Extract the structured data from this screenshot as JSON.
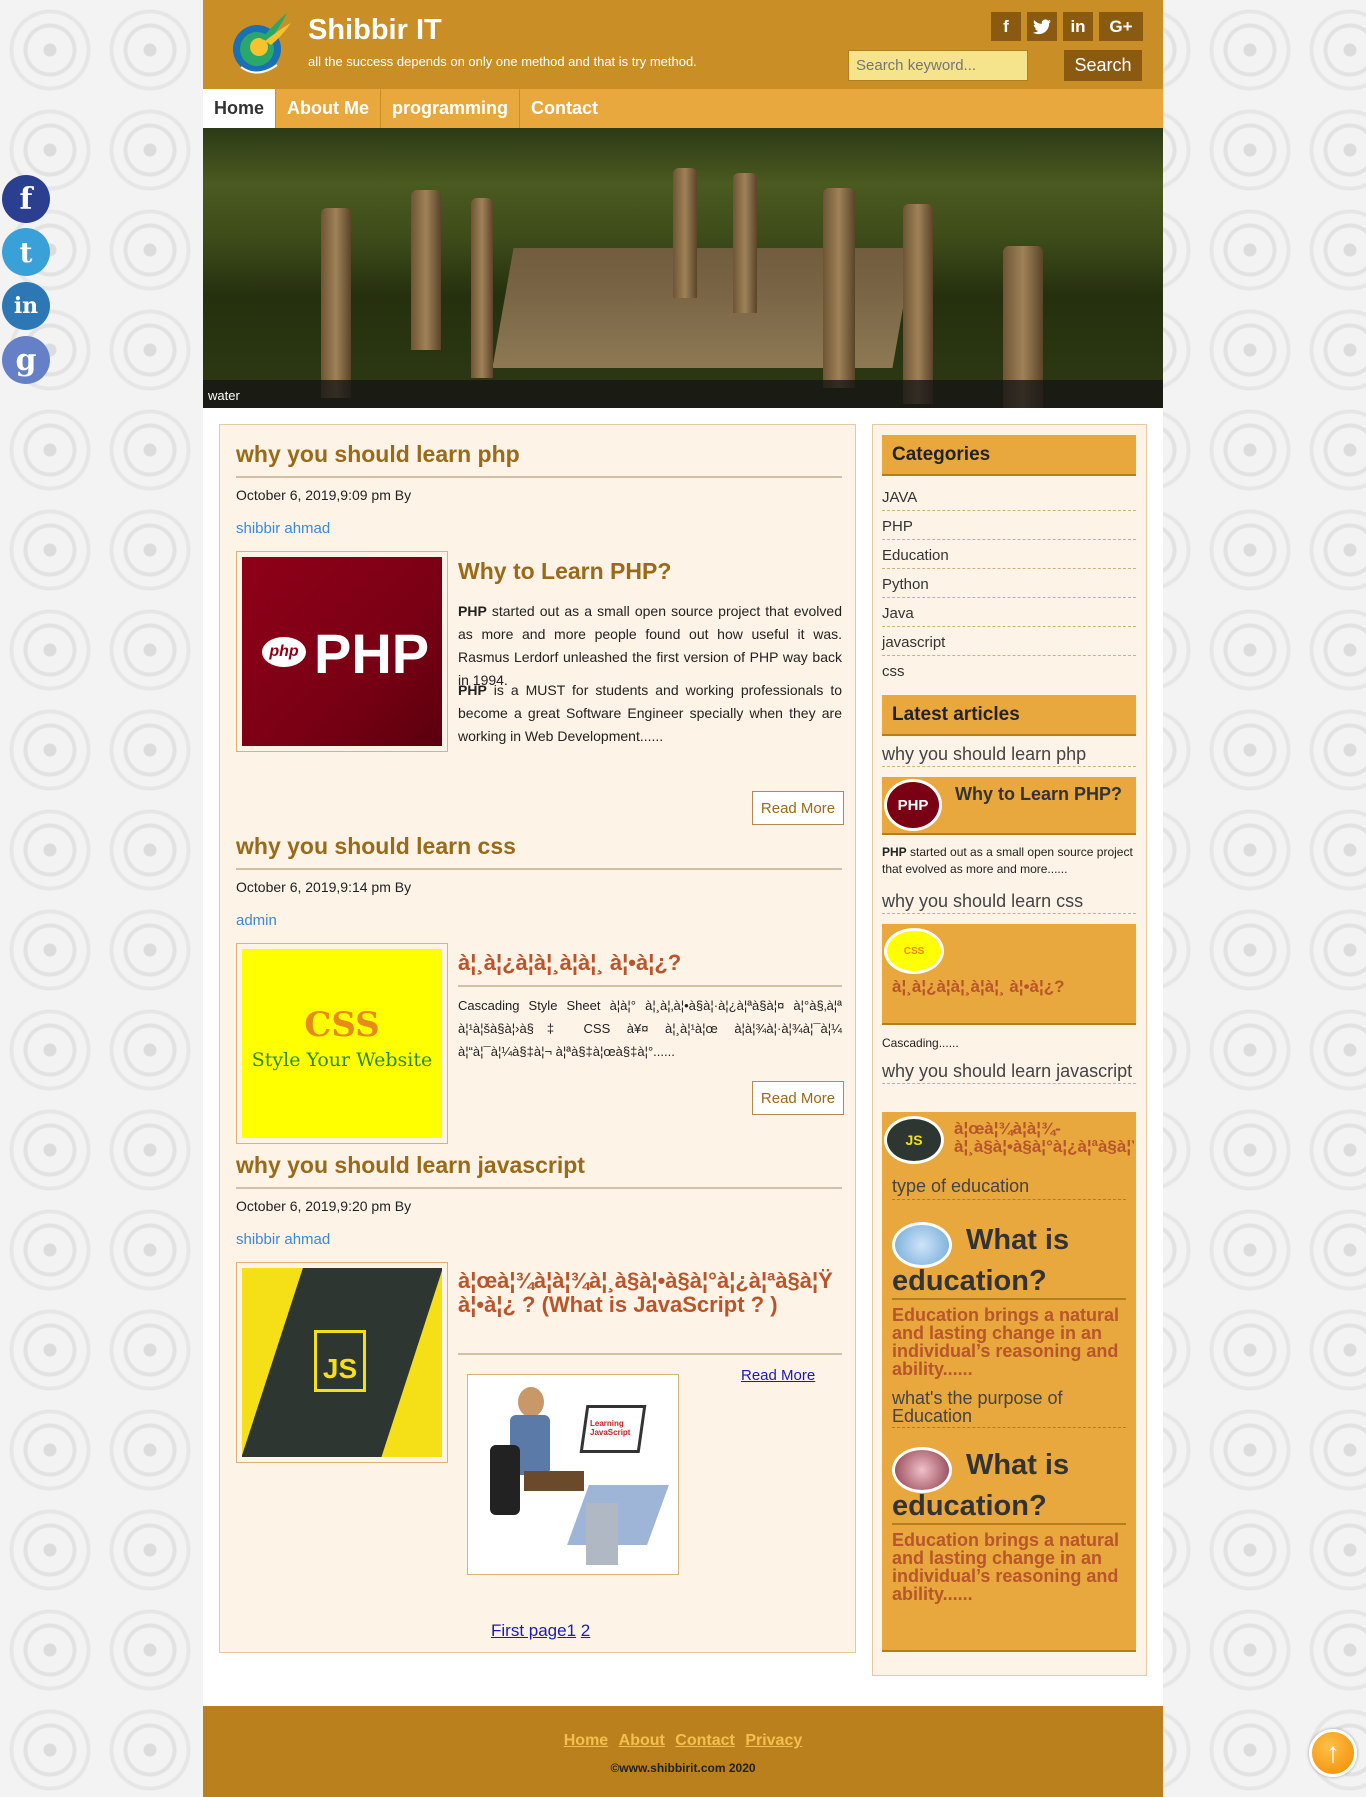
{
  "site": {
    "title": "Shibbir IT",
    "tagline": "all the success depends on only one method and that is try method."
  },
  "social_top": {
    "facebook": "f",
    "twitter": "t",
    "linkedin": "in",
    "googleplus": "G+"
  },
  "search": {
    "placeholder": "Search keyword...",
    "button": "Search"
  },
  "nav": [
    "Home",
    "About Me",
    "programming",
    "Contact"
  ],
  "hero": {
    "caption": "water"
  },
  "posts": [
    {
      "title": "why you should learn php",
      "date": "October 6, 2019,9:09 pm By",
      "author": "shibbir ahmad",
      "image_text": "PHP",
      "article_title": "Why to Learn PHP?",
      "para1_bold": "PHP",
      "para1": " started out as a small open source project that evolved as more and more people found out how useful it was. Rasmus Lerdorf unleashed the first version of PHP way back in 1994.",
      "para2_bold": "PHP",
      "para2": " is a MUST for students and working professionals to become a great Software Engineer specially when they are working in Web Development......",
      "read_more": "Read More"
    },
    {
      "title": "why you should learn css",
      "date": "October 6, 2019,9:14 pm By",
      "author": "admin",
      "image_text_1": "CSS",
      "image_text_2": "Style Your Website",
      "article_title": "à¦¸à¦¿à¦à¦¸à¦à¦¸ à¦•à¦¿?",
      "text": "Cascading Style Sheet à¦à¦° à¦¸à¦‚à¦•à§à¦·à¦¿à¦ªà§à¦¤ à¦°à§‚à¦ª à¦¹à¦šà§à¦›à§‡ CSS à¥¤ à¦¸à¦¹à¦œ à¦­à¦¾à¦·à¦¾à¦¯à¦¼ à¦“à¦¯à¦¼à§‡à¦¬ à¦ªà§‡à¦œà§‡à¦°......",
      "read_more": "Read More"
    },
    {
      "title": "why you should learn javascript",
      "date": "October 6, 2019,9:20 pm By",
      "author": "shibbir ahmad",
      "image_text": "JS",
      "article_title": "à¦œà¦¾à¦­à¦¾à¦¸à§à¦•à§à¦°à¦¿à¦ªà§à¦Ÿ à¦•à¦¿ ? (What is JavaScript ? )",
      "illustration_text": "Learning JavaScript",
      "read_more": "Read More"
    }
  ],
  "pager": {
    "first": "First page",
    "p1": "1",
    "p2": "2"
  },
  "sidebar": {
    "categories_title": "Categories",
    "categories": [
      "JAVA",
      "PHP",
      "Education",
      "Python",
      "Java",
      "javascript",
      "css"
    ],
    "latest_title": "Latest articles",
    "latest": [
      {
        "link": "why you should learn php",
        "box_title": "Why to Learn PHP?",
        "badge": "PHP",
        "excerpt_bold": "PHP",
        "excerpt": " started out as a small open source project that evolved as more and more......"
      },
      {
        "link": "why you should learn css",
        "box_title": "à¦¸à¦¿à¦à¦¸à¦à¦¸ à¦•à¦¿?",
        "badge": "CSS",
        "excerpt": "Cascading......"
      },
      {
        "link": "why you should learn javascript",
        "box_title": "à¦œà¦¾à¦­à¦¾-à¦¸à§à¦•à§à¦°à¦¿à¦ªà§à¦Ÿ",
        "badge": "JS"
      }
    ],
    "education": [
      {
        "link": "type of education",
        "title": "What is education?",
        "text": "Education brings a natural and lasting change in an individual’s reasoning and ability......"
      },
      {
        "link": "what's the purpose of Education",
        "title": "What is education?",
        "text": "Education brings a natural and lasting change in an individual’s reasoning and ability......"
      }
    ]
  },
  "footer": {
    "links": [
      "Home",
      "About",
      "Contact",
      "Privacy"
    ],
    "copyright": "©www.shibbirit.com 2020"
  },
  "float_social": {
    "facebook": "f",
    "twitter": "t",
    "linkedin": "in",
    "google": "g"
  },
  "scroll_top": "↑",
  "colors": {
    "header": "#c98f26",
    "nav": "#e8a83e",
    "footer": "#ba801e",
    "title": "#9a6a18",
    "accent_text": "#b8552a"
  }
}
